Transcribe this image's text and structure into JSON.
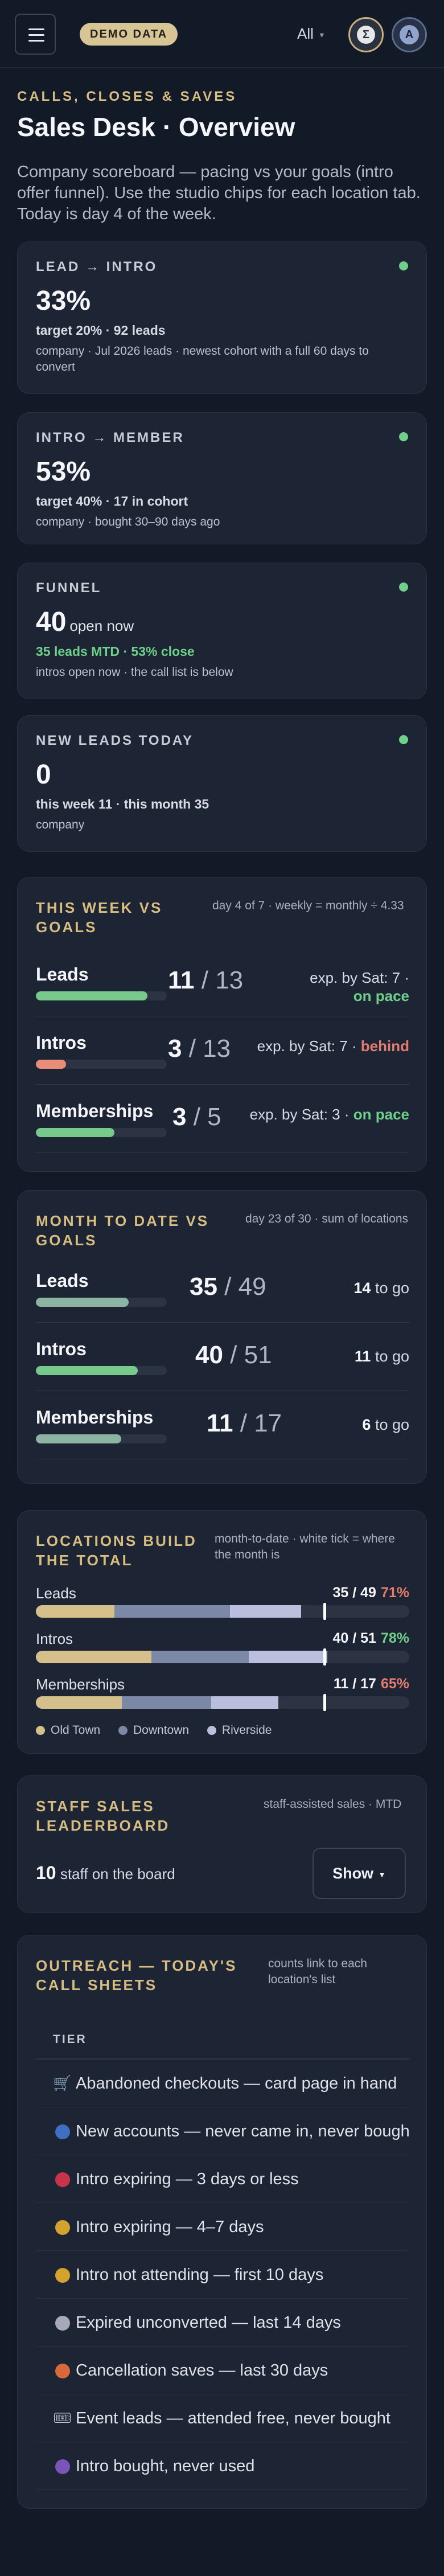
{
  "topbar": {
    "demo_badge": "DEMO DATA",
    "location_filter": "All",
    "studio_chip_letter": "Σ",
    "avatar_letter": "A"
  },
  "header": {
    "kicker": "CALLS, CLOSES & SAVES",
    "title": "Sales Desk · Overview",
    "intro": "Company scoreboard — pacing vs your goals (intro offer funnel). Use the studio chips for each location tab. Today is day 4 of the week."
  },
  "kpis": [
    {
      "label": "LEAD → INTRO",
      "value": "33%",
      "target": "target 20% · 92 leads",
      "note": "company · Jul 2026 leads · newest cohort with a full 60 days to convert"
    },
    {
      "label": "INTRO → MEMBER",
      "value": "53%",
      "target": "target 40% · 17 in cohort",
      "note": "company · bought 30–90 days ago"
    },
    {
      "label": "FUNNEL",
      "value": "40",
      "value_suffix": "open now",
      "target": "35 leads MTD · 53% close",
      "note": "intros open now · the call list is below"
    },
    {
      "label": "NEW LEADS TODAY",
      "value": "0",
      "target": "this week 11 · this month 35",
      "note": "company"
    }
  ],
  "colors": {
    "accent_gold": "#d8bd82",
    "status_green": "#6fd08b",
    "status_red": "#e27b6d",
    "week_bar_green": "#77c98c",
    "week_bar_red": "#e98d79",
    "month_bar_sage": "#8db3a2",
    "loc_old_town": "#d5bf8a",
    "loc_downtown": "#7b88a6",
    "loc_riverside": "#b9bfdc"
  },
  "week_goals": {
    "title": "THIS WEEK VS GOALS",
    "subtitle": "day 4 of 7 · weekly = monthly ÷ 4.33",
    "rows": [
      {
        "label": "Leads",
        "actual": "11",
        "goal": "13",
        "progress": 0.85,
        "expectation": "exp. by Sat: 7 ·",
        "status": "on pace",
        "status_kind": "good"
      },
      {
        "label": "Intros",
        "actual": "3",
        "goal": "13",
        "progress": 0.23,
        "expectation": "exp. by Sat: 7 ·",
        "status": "behind",
        "status_kind": "bad"
      },
      {
        "label": "Memberships",
        "actual": "3",
        "goal": "5",
        "progress": 0.6,
        "expectation": "exp. by Sat: 3 ·",
        "status": "on pace",
        "status_kind": "good"
      }
    ]
  },
  "month_to_date": {
    "title": "MONTH TO DATE VS GOALS",
    "subtitle": "day 23 of 30 · sum of locations",
    "rows": [
      {
        "label": "Leads",
        "actual": "35",
        "goal": "49",
        "progress": 0.71,
        "to_go": "14",
        "to_go_label": "to go"
      },
      {
        "label": "Intros",
        "actual": "40",
        "goal": "51",
        "progress": 0.78,
        "to_go": "11",
        "to_go_label": "to go"
      },
      {
        "label": "Memberships",
        "actual": "11",
        "goal": "17",
        "progress": 0.65,
        "to_go": "6",
        "to_go_label": "to go"
      }
    ]
  },
  "locations": {
    "title": "LOCATIONS BUILD THE TOTAL",
    "subtitle": "month-to-date · white tick = where the month is",
    "month_position": 0.77,
    "legend": [
      "Old Town",
      "Downtown",
      "Riverside"
    ],
    "rows": [
      {
        "label": "Leads",
        "value": "35 / 49",
        "pct": "71%",
        "pct_kind": "bad",
        "shares": [
          0.21,
          0.31,
          0.19
        ]
      },
      {
        "label": "Intros",
        "value": "40 / 51",
        "pct": "78%",
        "pct_kind": "good",
        "shares": [
          0.31,
          0.26,
          0.21
        ]
      },
      {
        "label": "Memberships",
        "value": "11 / 17",
        "pct": "65%",
        "pct_kind": "bad",
        "shares": [
          0.23,
          0.24,
          0.18
        ]
      }
    ]
  },
  "leaderboard": {
    "title": "STAFF SALES LEADERBOARD",
    "subtitle": "staff-assisted sales · MTD",
    "count": "10",
    "count_label": "staff on the board",
    "show_label": "Show"
  },
  "outreach": {
    "title": "OUTREACH — TODAY'S CALL SHEETS",
    "subtitle": "counts link to each location's list",
    "column_header": "TIER",
    "tiers": [
      {
        "icon": "cart-icon",
        "glyph": "🛒",
        "label": "Abandoned checkouts — card page in hand"
      },
      {
        "icon": "blue-dot-icon",
        "color": "#3f6fc4",
        "label": "New accounts — never came in, never bought"
      },
      {
        "icon": "red-dot-icon",
        "color": "#c8334a",
        "label": "Intro expiring — 3 days or less"
      },
      {
        "icon": "yellow-dot-icon",
        "color": "#d4a32e",
        "label": "Intro expiring — 4–7 days"
      },
      {
        "icon": "yellow-dot-icon",
        "color": "#d4a32e",
        "label": "Intro not attending — first 10 days"
      },
      {
        "icon": "grey-dot-icon",
        "color": "#a7a9b6",
        "label": "Expired unconverted — last 14 days"
      },
      {
        "icon": "orange-dot-icon",
        "color": "#d66a3c",
        "label": "Cancellation saves — last 30 days"
      },
      {
        "icon": "ticket-icon",
        "glyph": "🎟",
        "label": "Event leads — attended free, never bought"
      },
      {
        "icon": "purple-dot-icon",
        "color": "#7a55b8",
        "label": "Intro bought, never used"
      }
    ]
  }
}
